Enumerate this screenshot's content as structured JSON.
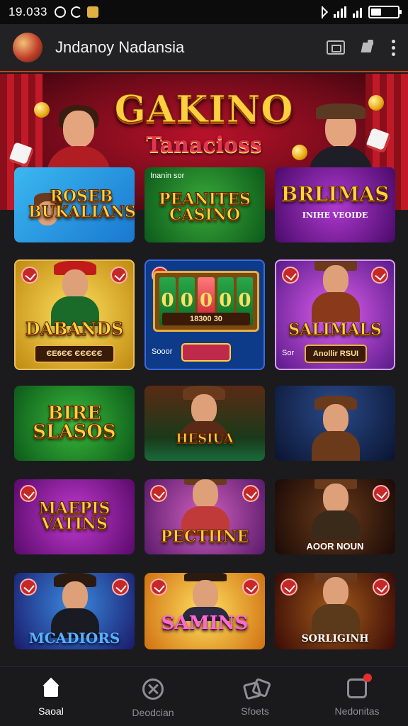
{
  "status_bar": {
    "time": "19.033"
  },
  "app_bar": {
    "title": "Jndanoy Nadansia"
  },
  "hero": {
    "title": "GAKINO",
    "subtitle": "Tanacioss"
  },
  "games": [
    {
      "title": "ROSEB BUKALIANS",
      "badge": "",
      "tag": ""
    },
    {
      "title": "PEANITES CASINO",
      "badge": "Inanin sor",
      "tag": ""
    },
    {
      "title": "BRLIMAS",
      "badge": "INIHE VEOIDE",
      "tag": ""
    },
    {
      "title": "DABANDS",
      "badge": "ЄЕ6ЄЄ ЄЄЄЄЄ",
      "tag": ""
    },
    {
      "title": "",
      "badge": "18300 30",
      "tag": "Sooor"
    },
    {
      "title": "SALIMALS",
      "badge": "Anollir RSUI",
      "tag": "Sor"
    },
    {
      "title": "BIRE SLASOS",
      "badge": "",
      "tag": ""
    },
    {
      "title": "HESIUA",
      "badge": "",
      "tag": ""
    },
    {
      "title": "",
      "badge": "",
      "tag": ""
    },
    {
      "title": "MAEPIS VATINS",
      "badge": "",
      "tag": ""
    },
    {
      "title": "PECTIINE",
      "badge": "",
      "tag": ""
    },
    {
      "title": "AOOR NOUN",
      "badge": "",
      "tag": ""
    },
    {
      "title": "MCADIORS",
      "badge": "",
      "tag": ""
    },
    {
      "title": "SAMINS",
      "badge": "",
      "tag": ""
    },
    {
      "title": "SORLIGINH",
      "badge": "",
      "tag": ""
    }
  ],
  "bottom_nav": [
    {
      "label": "Saoal",
      "icon": "home-icon",
      "active": true
    },
    {
      "label": "Deodcian",
      "icon": "close-circle-icon",
      "active": false
    },
    {
      "label": "Sfoets",
      "icon": "dice-icon",
      "active": false
    },
    {
      "label": "Nedonitas",
      "icon": "notification-icon",
      "active": false
    }
  ],
  "colors": {
    "accent": "#d0401a",
    "gold": "#ffd23c",
    "background": "#1b1b1d"
  }
}
